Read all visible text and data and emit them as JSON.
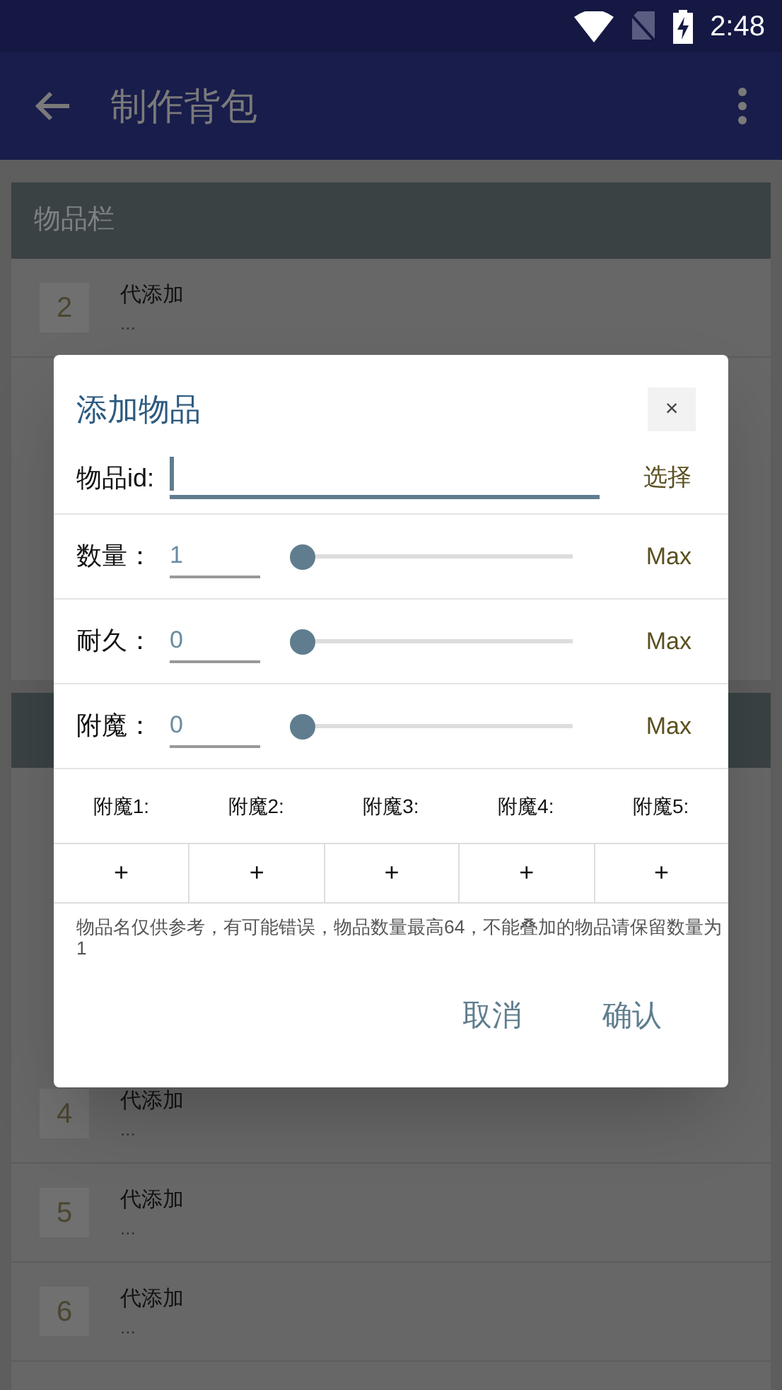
{
  "status_bar": {
    "time": "2:48"
  },
  "app_bar": {
    "title": "制作背包"
  },
  "sections": [
    {
      "title": "物品栏",
      "rows": [
        {
          "number": "2",
          "title": "代添加",
          "subtitle": "..."
        }
      ]
    },
    {
      "rows": [
        {
          "number": "4",
          "title": "代添加",
          "subtitle": "..."
        },
        {
          "number": "5",
          "title": "代添加",
          "subtitle": "..."
        },
        {
          "number": "6",
          "title": "代添加",
          "subtitle": "..."
        }
      ]
    }
  ],
  "dialog": {
    "title": "添加物品",
    "close": "×",
    "id_field": {
      "label": "物品id:",
      "focused": true,
      "action": "选择"
    },
    "sliders": [
      {
        "label": "数量：",
        "value": "1",
        "level": 0,
        "max": "Max"
      },
      {
        "label": "耐久：",
        "value": "0",
        "level": 0,
        "max": "Max"
      },
      {
        "label": "附魔：",
        "value": "0",
        "level": 0,
        "max": "Max"
      }
    ],
    "enchant_slots": [
      {
        "label": "附魔1:",
        "add": "+"
      },
      {
        "label": "附魔2:",
        "add": "+"
      },
      {
        "label": "附魔3:",
        "add": "+"
      },
      {
        "label": "附魔4:",
        "add": "+"
      },
      {
        "label": "附魔5:",
        "add": "+"
      }
    ],
    "note": "物品名仅供参考，有可能错误，物品数量最高64，不能叠加的物品请保留数量为1",
    "buttons": [
      "取消",
      "确认"
    ]
  }
}
